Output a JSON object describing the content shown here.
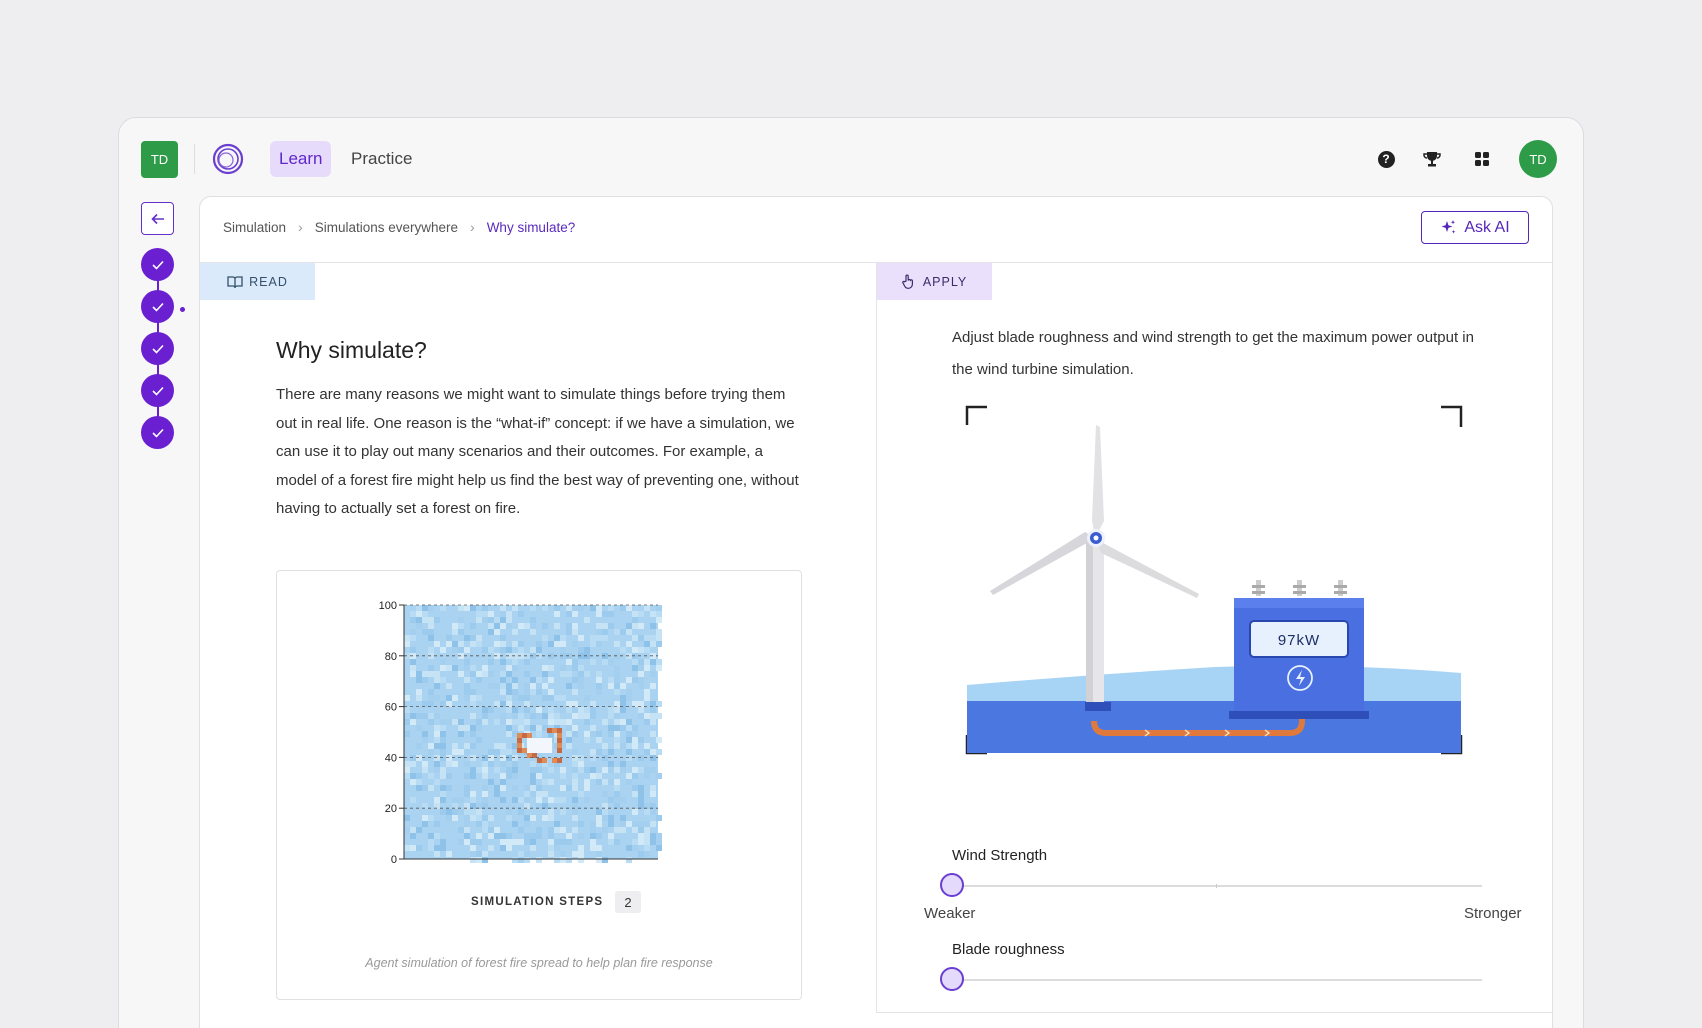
{
  "user": {
    "initials": "TD"
  },
  "nav": {
    "learn": "Learn",
    "practice": "Practice"
  },
  "breadcrumb": {
    "items": [
      "Simulation",
      "Simulations everywhere"
    ],
    "current": "Why simulate?"
  },
  "ask_ai": "Ask AI",
  "tabs": {
    "read": "READ",
    "apply": "APPLY"
  },
  "progress": {
    "completed_steps": 5,
    "current_step": 2
  },
  "read": {
    "title": "Why simulate?",
    "body": "There are many reasons we might want to simulate things before trying them out in real life. One reason is the “what-if” concept: if we have a simulation, we can use it to play out many scenarios and their outcomes. For example, a model of a forest fire might help us find the best way of preventing one, without having to actually set a forest on fire."
  },
  "figure": {
    "steps_label": "SIMULATION STEPS",
    "steps_value": "2",
    "caption": "Agent simulation of forest fire spread to help plan fire response"
  },
  "chart_data": {
    "type": "heatmap",
    "y_ticks": [
      "100",
      "80",
      "60",
      "40",
      "20",
      "0"
    ],
    "ylim": [
      0,
      100
    ],
    "grid": true,
    "gridlines": [
      20,
      40,
      60,
      80,
      100
    ]
  },
  "apply": {
    "instruction": "Adjust blade roughness and wind strength to get the maximum power output in the wind turbine simulation.",
    "power_readout": "97kW"
  },
  "sliders": {
    "wind": {
      "label": "Wind Strength",
      "min_label": "Weaker",
      "max_label": "Stronger",
      "value": 0
    },
    "blade": {
      "label": "Blade roughness",
      "value": 0
    }
  },
  "colors": {
    "accent": "#6a1fd0",
    "brand_green": "#2e9b48",
    "water": "#4a77e0"
  }
}
